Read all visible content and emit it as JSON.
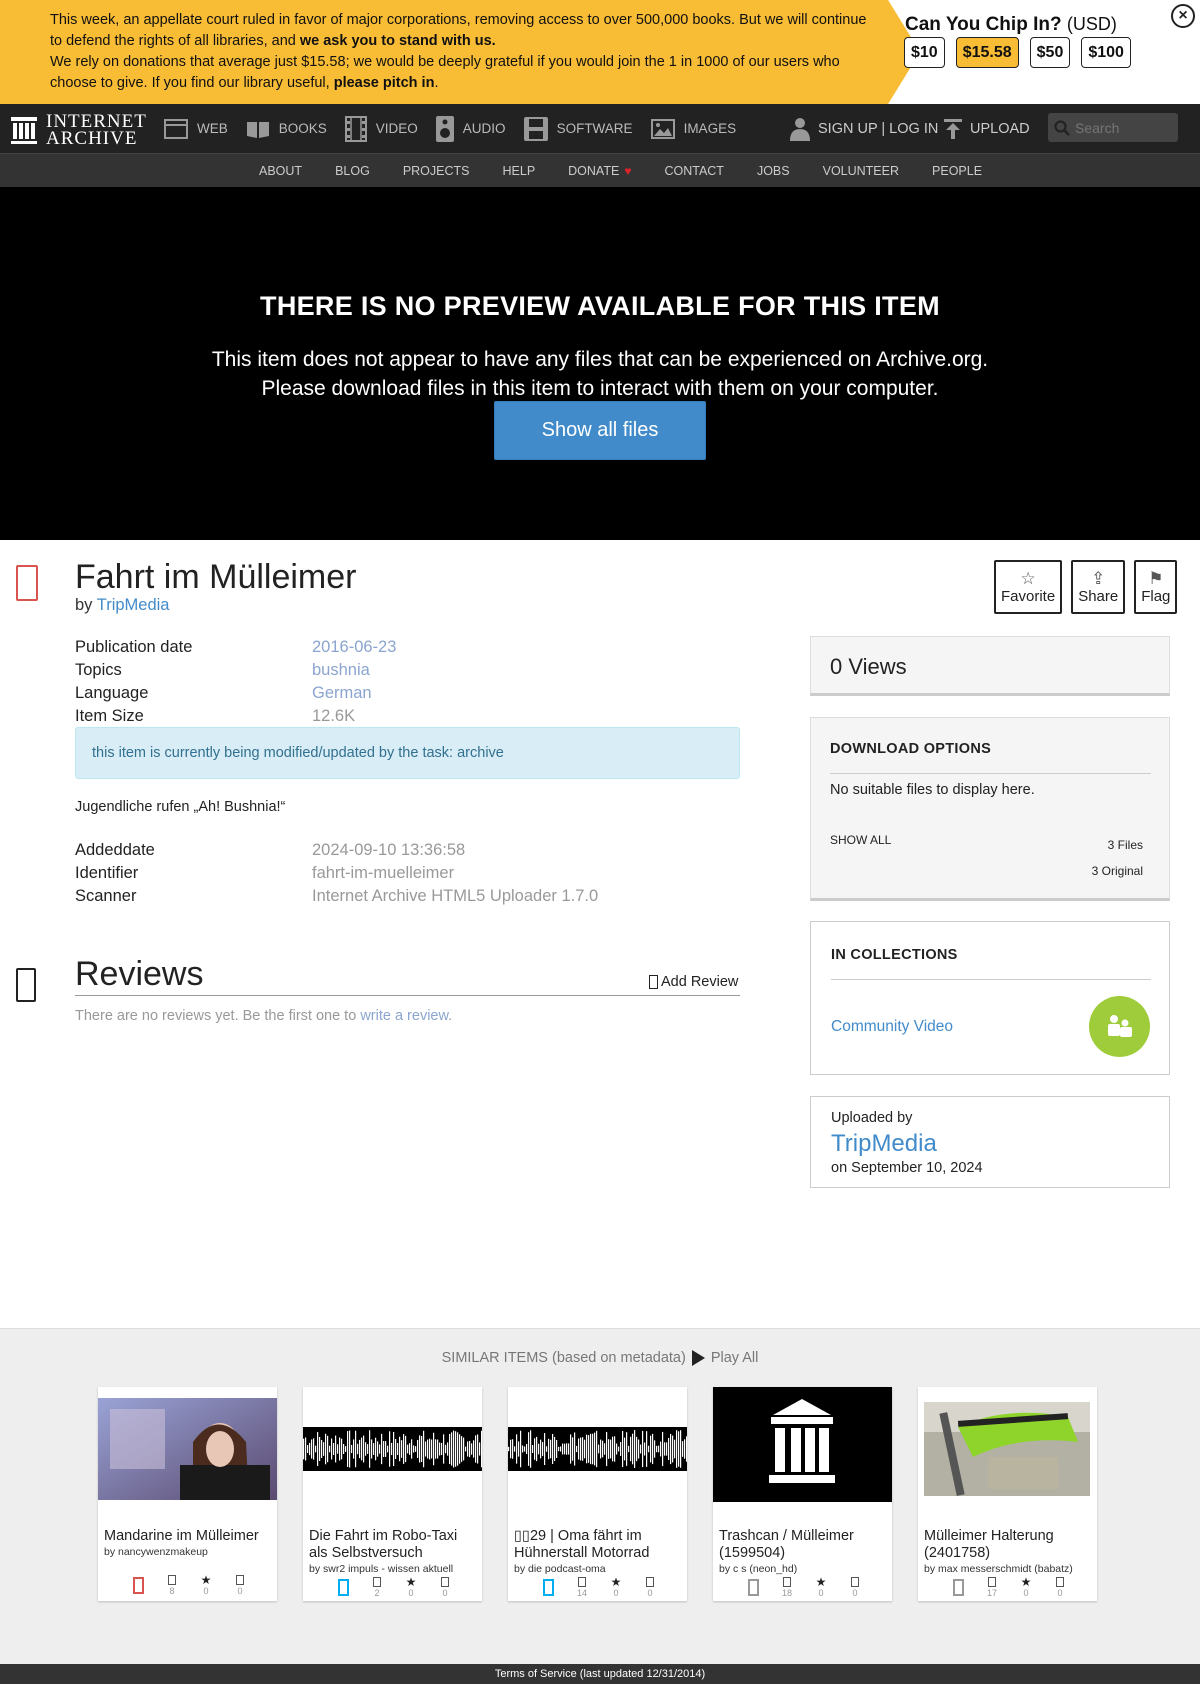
{
  "banner": {
    "line1a": "This week, an appellate court ruled in favor of major corporations, removing access to over 500,000 books. But we will continue to defend the rights of all libraries, and ",
    "line1b": "we ask you to stand with us.",
    "line2a": "We rely on donations that average just $15.58; we would be deeply grateful if you would join the 1 in 1000 of our users who choose to give. If you find our library useful, ",
    "line2b": "please pitch in",
    "line2c": ".",
    "chip_title": "Can You Chip In?",
    "currency": "(USD)",
    "amounts": [
      "$10",
      "$15.58",
      "$50",
      "$100"
    ],
    "close": "×"
  },
  "nav": {
    "logo_line1": "INTERNET",
    "logo_line2": "ARCHIVE",
    "items": [
      "WEB",
      "BOOKS",
      "VIDEO",
      "AUDIO",
      "SOFTWARE",
      "IMAGES"
    ],
    "signup": "SIGN UP | LOG IN",
    "upload": "UPLOAD",
    "search_placeholder": "Search"
  },
  "subnav": [
    "ABOUT",
    "BLOG",
    "PROJECTS",
    "HELP",
    "DONATE",
    "CONTACT",
    "JOBS",
    "VOLUNTEER",
    "PEOPLE"
  ],
  "preview": {
    "heading": "THERE IS NO PREVIEW AVAILABLE FOR THIS ITEM",
    "line1": "This item does not appear to have any files that can be experienced on Archive.org.",
    "line2": "Please download files in this item to interact with them on your computer.",
    "button": "Show all files"
  },
  "item": {
    "title": "Fahrt im Mülleimer",
    "by_prefix": "by",
    "creator": "TripMedia",
    "actions": [
      "Favorite",
      "Share",
      "Flag"
    ],
    "meta": [
      {
        "key": "Publication date",
        "value": "2016-06-23"
      },
      {
        "key": "Topics",
        "value": "bushnia"
      },
      {
        "key": "Language",
        "value": "German"
      },
      {
        "key": "Item Size",
        "value": "12.6K"
      }
    ],
    "alert": "this item is currently being modified/updated by the task: archive",
    "description": "Jugendliche rufen „Ah! Bushnia!“",
    "meta2": [
      {
        "key": "Addeddate",
        "value": "2024-09-10 13:36:58"
      },
      {
        "key": "Identifier",
        "value": "fahrt-im-muelleimer"
      },
      {
        "key": "Scanner",
        "value": "Internet Archive HTML5 Uploader 1.7.0"
      }
    ]
  },
  "reviews": {
    "title": "Reviews",
    "add": "Add Review",
    "none_prefix": "There are no reviews yet. Be the first one to ",
    "none_link": "write a review",
    "none_suffix": "."
  },
  "sidebar": {
    "views": "0 Views",
    "download_head": "DOWNLOAD OPTIONS",
    "no_files": "No suitable files to display here.",
    "show_all": "SHOW ALL",
    "files_count": "3 Files",
    "original_count": "3 Original",
    "collections_head": "IN COLLECTIONS",
    "collection": "Community Video",
    "uploaded_by": "Uploaded by",
    "uploader": "TripMedia",
    "upload_date": "on September 10, 2024"
  },
  "similar": {
    "heading": "SIMILAR ITEMS (based on metadata)",
    "play_all": "Play All",
    "cards": [
      {
        "title": "Mandarine im Mülleimer",
        "by": "by nancywenzmakeup",
        "views": "8",
        "favs": "0",
        "reviews": "0"
      },
      {
        "title": "Die Fahrt im Robo-Taxi als Selbstversuch",
        "by": "by swr2 impuls - wissen aktuell",
        "views": "2",
        "favs": "0",
        "reviews": "0"
      },
      {
        "title": "29 | Oma fährt im Hühnerstall Motorrad",
        "by": "by die podcast-oma",
        "views": "14",
        "favs": "0",
        "reviews": "0"
      },
      {
        "title": "Trashcan / Mülleimer (1599504)",
        "by": "by c s (neon_hd)",
        "views": "18",
        "favs": "0",
        "reviews": "0"
      },
      {
        "title": "Mülleimer Halterung (2401758)",
        "by": "by max messerschmidt (babatz)",
        "views": "17",
        "favs": "0",
        "reviews": "0"
      }
    ]
  },
  "footer": "Terms of Service (last updated 12/31/2014)",
  "colors": {
    "banner": "#f9bc35",
    "link": "#428bca",
    "badge": "#9ecc3b",
    "button": "#428bca"
  }
}
